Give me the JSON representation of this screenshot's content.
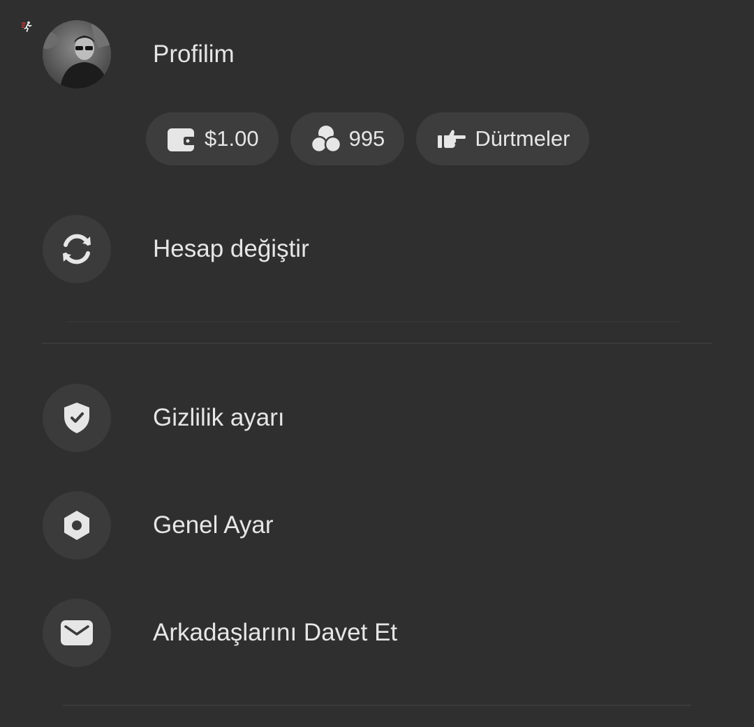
{
  "profile": {
    "title": "Profilim"
  },
  "chips": {
    "wallet_amount": "$1.00",
    "coins_count": "995",
    "pokes_label": "Dürtmeler"
  },
  "menu": {
    "switch_account": "Hesap değiştir",
    "privacy_settings": "Gizlilik ayarı",
    "general_settings": "Genel Ayar",
    "invite_friends": "Arkadaşlarını Davet Et"
  },
  "icons": {
    "corner": "running-person-badge-icon",
    "wallet": "wallet-icon",
    "coins": "coins-icon",
    "pokes": "hand-pointing-icon",
    "switch": "sync-icon",
    "privacy": "shield-check-icon",
    "general": "hexagon-settings-icon",
    "invite": "envelope-icon"
  },
  "colors": {
    "background": "#2f2f2f",
    "chip_background": "#3d3d3d",
    "circle_background": "#3b3b3b",
    "text": "#e6e6e6",
    "badge_red": "#d33a3a"
  }
}
